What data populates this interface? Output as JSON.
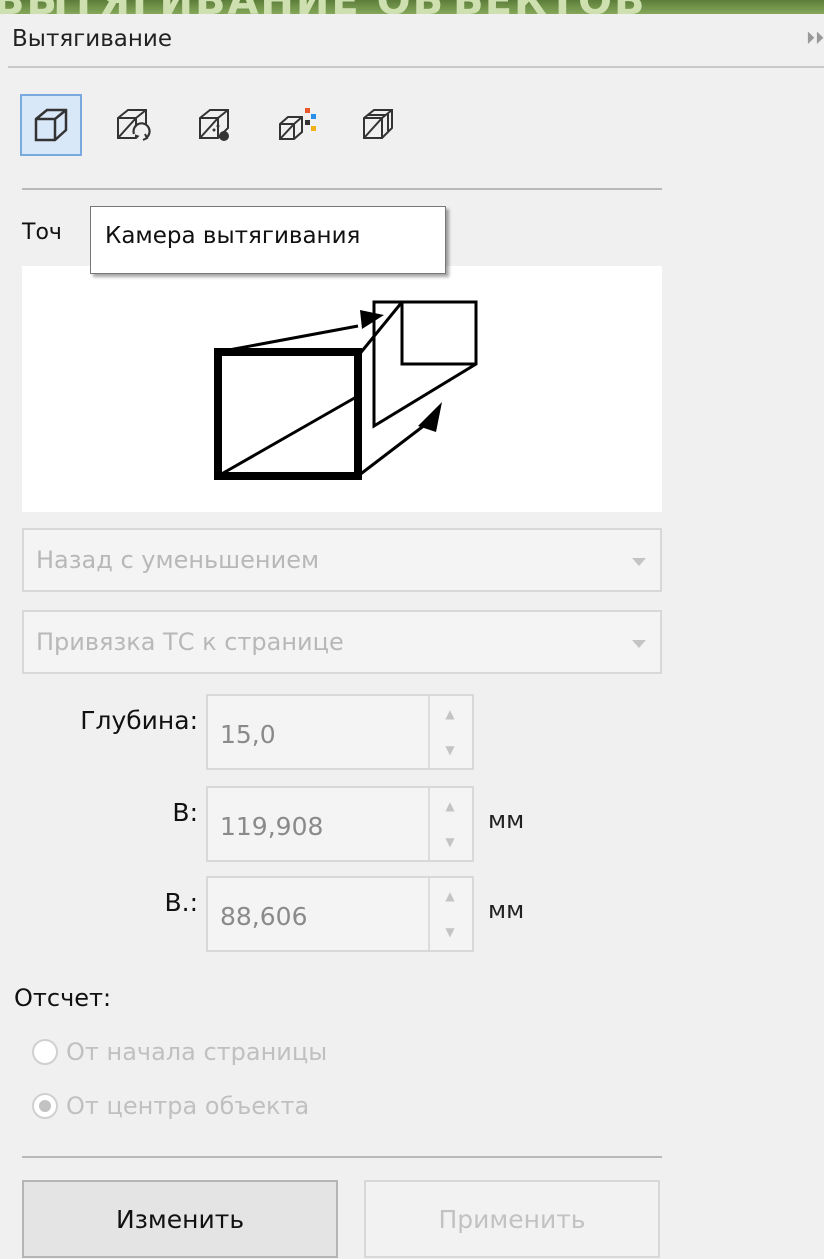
{
  "panel": {
    "title": "Вытягивание",
    "collapse_glyph": "⏵⏵"
  },
  "mode_icons": [
    {
      "name": "extrude-mode-icon",
      "active": true
    },
    {
      "name": "extrude-rotation-icon",
      "active": false
    },
    {
      "name": "extrude-lighting-icon",
      "active": false
    },
    {
      "name": "extrude-color-icon",
      "active": false
    },
    {
      "name": "extrude-bevel-icon",
      "active": false
    }
  ],
  "vanishing_point": {
    "label_partial": "Точ",
    "tooltip": "Камера вытягивания"
  },
  "extrusion_type": {
    "value": "Назад с уменьшением"
  },
  "vp_lock": {
    "value": "Привязка ТС к странице"
  },
  "depth": {
    "label": "Глубина:",
    "value": "15,0"
  },
  "horizontal": {
    "label": "В:",
    "value": "119,908",
    "unit": "мм"
  },
  "vertical": {
    "label": "В.:",
    "value": "88,606",
    "unit": "мм"
  },
  "origin": {
    "label": "Отсчет:",
    "options": [
      {
        "label": "От начала страницы",
        "checked": false
      },
      {
        "label": "От центра объекта",
        "checked": true
      }
    ]
  },
  "buttons": {
    "edit": "Изменить",
    "apply": "Применить"
  },
  "colors": {
    "accent": "#7aa9e0",
    "active_bg": "#d9e8f8",
    "panel_bg": "#f0f0f0"
  }
}
